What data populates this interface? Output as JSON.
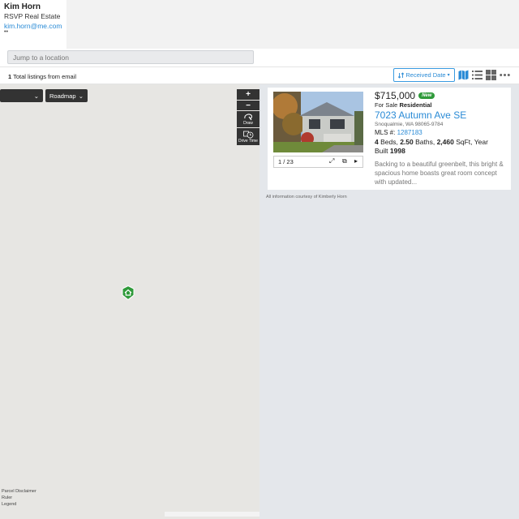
{
  "agent": {
    "name": "Kim Horn",
    "company": "RSVP Real Estate",
    "email": "kim.horn@me.com"
  },
  "search": {
    "placeholder": "Jump to a location"
  },
  "listings_bar": {
    "count": "1",
    "count_suffix": " Total listings from email",
    "sort_label": "Received Date"
  },
  "view_icons": [
    "map-view-icon",
    "list-view-icon",
    "grid-view-icon",
    "more-icon"
  ],
  "map": {
    "layer_select": "",
    "type_select": "Roadmap",
    "zoom_in": "+",
    "zoom_out": "−",
    "draw_label": "Draw",
    "drive_time_label": "Drive Time",
    "footer": [
      "Parcel Disclaimer",
      "Ruler",
      "Legend"
    ]
  },
  "listing": {
    "price": "$715,000",
    "badge": "New",
    "status_prefix": "For Sale ",
    "status_type": "Residential",
    "address": "7023 Autumn Ave SE",
    "city": "Snoqualmie, WA 98065-9784",
    "mls_label": "MLS #: ",
    "mls_number": "1287183",
    "beds": "4",
    "beds_label": " Beds, ",
    "baths": "2.50",
    "baths_label": " Baths, ",
    "sqft": "2,460",
    "sqft_label": " SqFt, Year Built ",
    "year_built": "1998",
    "description": "Backing to a beautiful greenbelt, this bright & spacious home boasts great room concept with updated...",
    "photo_counter": "1 / 23"
  },
  "courtesy": "All information courtesy of Kimberly Horn",
  "colors": {
    "accent": "#2a8bd6",
    "badge": "#2f9a3a",
    "marker": "#2f9a3a"
  }
}
